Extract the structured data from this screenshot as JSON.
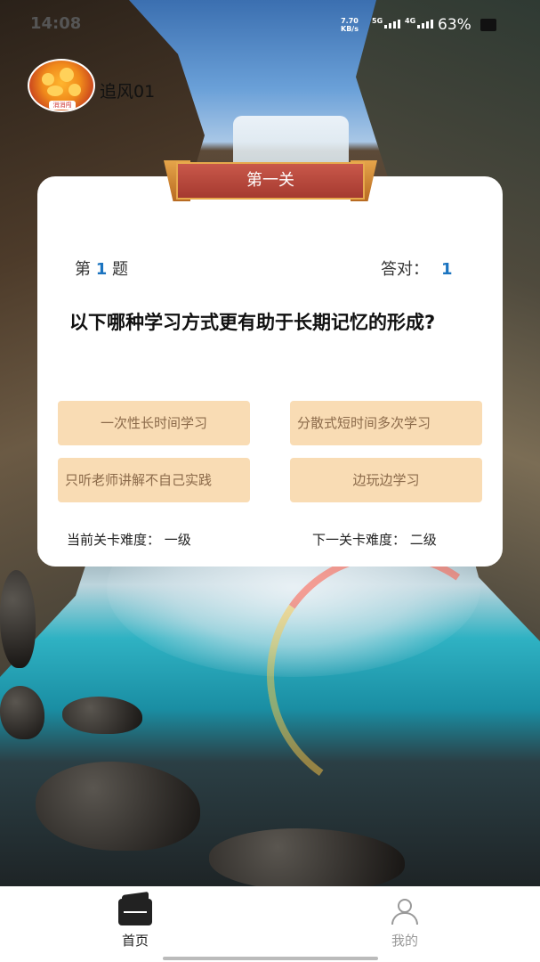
{
  "status_bar": {
    "time": "14:08",
    "net_speed": "7.70",
    "net_unit": "KB/s",
    "sig1": "5G",
    "sig2": "4G",
    "battery": "63%"
  },
  "user": {
    "avatar_text": "消消闯",
    "name": "追风01"
  },
  "level": {
    "title": "第一关"
  },
  "quiz": {
    "question_prefix": "第",
    "question_number": "1",
    "question_suffix": "题",
    "correct_label": "答对：",
    "correct_count": "1",
    "question": "以下哪种学习方式更有助于长期记忆的形成?",
    "options": [
      "一次性长时间学习",
      "分散式短时间多次学习",
      "只听老师讲解不自己实践",
      "边玩边学习"
    ],
    "current_difficulty": "当前关卡难度：  一级",
    "next_difficulty": "下一关卡难度：  二级"
  },
  "tabbar": {
    "home_label": "首页",
    "mine_label": "我的"
  },
  "colors": {
    "accent": "#1b74c0",
    "option_bg": "#f9dcb4",
    "option_text": "#8b6a4a",
    "banner": "#b3453a"
  }
}
